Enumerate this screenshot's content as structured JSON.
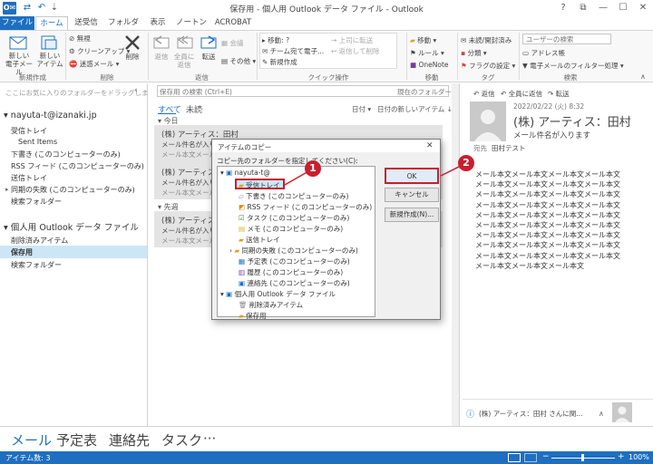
{
  "window": {
    "title": "保存用 - 個人用 Outlook データ ファイル - Outlook",
    "app_icon": "O✉"
  },
  "qat": {
    "send_receive_icon": "⇄",
    "undo_icon": "↶",
    "customize_icon": "⇣"
  },
  "window_controls": {
    "help": "?",
    "restore": "⧉",
    "minimize": "—",
    "maximize": "☐",
    "close": "✕"
  },
  "tabs": {
    "file": "ファイル",
    "home": "ホーム",
    "send_receive": "送受信",
    "folder": "フォルダー",
    "view": "表示",
    "norton": "ノートン",
    "acrobat": "ACROBAT"
  },
  "ribbon": {
    "new_email": "新しい\n電子メール",
    "new_items": "新しい\nアイテム",
    "ignore": "無視",
    "cleanup": "クリーンアップ",
    "junk": "迷惑メール",
    "delete": "削除",
    "reply": "返信",
    "reply_all": "全員に\n返信",
    "forward": "転送",
    "meeting": "会議",
    "more": "その他",
    "qs_move": "移動: ?",
    "qs_team": "チーム宛て電子...",
    "qs_new": "新規作成",
    "qs_to_manager": "上司に転送",
    "qs_reply_delete": "返信して削除",
    "move": "移動",
    "rules": "ルール",
    "onenote": "OneNote",
    "unread_read": "未読/開封済み",
    "categorize": "分類",
    "followup": "フラグの設定",
    "search_people_placeholder": "ユーザーの検索",
    "address_book": "アドレス帳",
    "filter_email": "電子メールのフィルター処理",
    "groups": {
      "new": "新規作成",
      "delete": "削除",
      "respond": "返信",
      "quick_steps": "クイック操作",
      "move": "移動",
      "tags": "タグ",
      "find": "検索"
    }
  },
  "nav": {
    "favorites_hint": "ここにお気に入りのフォルダーをドラッグします",
    "account": "nayuta-t@izanaki.jp",
    "account_folders": [
      "受信トレイ",
      "Sent Items",
      "下書き (このコンピューターのみ)",
      "RSS フィード (このコンピューターのみ)",
      "送信トレイ",
      "同期の失敗 (このコンピューターのみ)",
      "検索フォルダー"
    ],
    "pst": "個人用 Outlook データ ファイル",
    "pst_folders": [
      "削除済みアイテム",
      "保存用",
      "検索フォルダー"
    ]
  },
  "list": {
    "search_placeholder": "保存用 の検索 (Ctrl+E)",
    "scope": "現在のフォルダー",
    "filter_all": "すべて",
    "filter_unread": "未読",
    "sort_by": "日付",
    "sort_order": "日付の新しいアイテム",
    "group_today": "今日",
    "group_last_week": "先週",
    "messages": [
      {
        "from": "(株) アーティス：田村",
        "subject": "メール件名が入ります",
        "preview": "メール本文メール本文"
      },
      {
        "from": "(株) アーティス：田村",
        "subject": "メール件名が入ります",
        "preview": "メール本文メール本文"
      },
      {
        "from": "(株) アーティス：田村",
        "subject": "メール件名が入ります",
        "preview": "メール本文メール本文"
      }
    ]
  },
  "reading": {
    "reply": "返信",
    "reply_all": "全員に返信",
    "forward": "転送",
    "date": "2022/02/22 (火) 8:32",
    "from": "(株) アーティス：田村",
    "subject": "メール件名が入ります",
    "to_label": "宛先",
    "to": "田村テスト",
    "body_lines": [
      "メール本文メール本文メール本文メール本文",
      "メール本文メール本文メール本文メール本文",
      "メール本文メール本文メール本文メール本文",
      "メール本文メール本文メール本文メール本文",
      "メール本文メール本文メール本文メール本文",
      "メール本文メール本文メール本文メール本文",
      "メール本文メール本文メール本文メール本文",
      "メール本文メール本文メール本文メール本文",
      "メール本文メール本文メール本文メール本文",
      "メール本文メール本文メール本文"
    ],
    "people_pane": "(株) アーティス：田村 さんに関..."
  },
  "bottomnav": {
    "mail": "メール",
    "calendar": "予定表",
    "people": "連絡先",
    "tasks": "タスク",
    "more": "···"
  },
  "status": {
    "items": "アイテム数: 3",
    "zoom": "100%"
  },
  "dialog": {
    "title": "アイテムのコピー",
    "prompt": "コピー先のフォルダーを指定してください(C):",
    "tree": {
      "account": "nayuta-t@",
      "folders": [
        "受信トレイ",
        "下書き (このコンピューターのみ)",
        "RSS フィード (このコンピューターのみ)",
        "タスク (このコンピューターのみ)",
        "メモ (このコンピューターのみ)",
        "送信トレイ",
        "同期の失敗 (このコンピューターのみ)",
        "予定表 (このコンピューターのみ)",
        "履歴 (このコンピューターのみ)",
        "連絡先 (このコンピューターのみ)"
      ],
      "pst": "個人用 Outlook データ ファイル",
      "pst_folders": [
        "削除済みアイテム",
        "保存用"
      ]
    },
    "ok": "OK",
    "cancel": "キャンセル",
    "new_folder": "新規作成(N)...",
    "close": "✕"
  },
  "callouts": {
    "one": "1",
    "two": "2"
  },
  "colors": {
    "accent": "#1e6fc0",
    "callout": "#c81f2e",
    "selection": "#cde6f7"
  }
}
